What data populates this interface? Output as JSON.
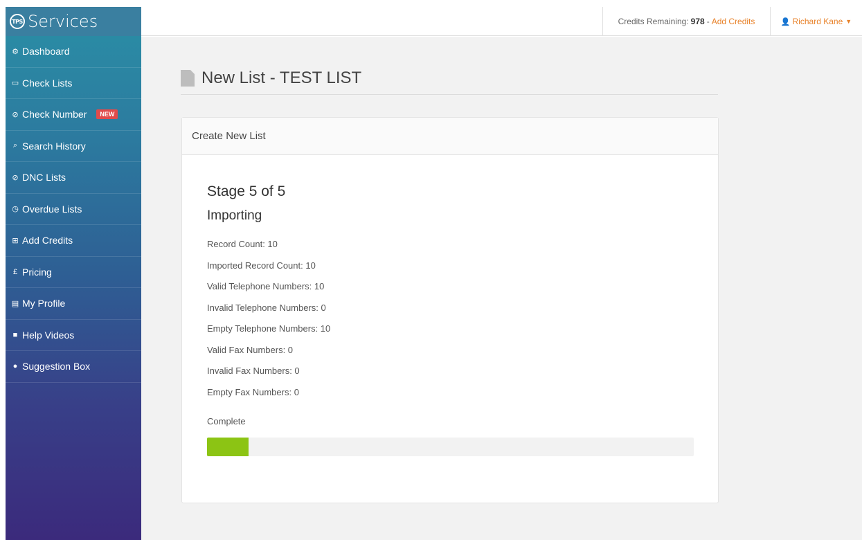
{
  "brand": {
    "logo_text": "TPS",
    "name": "Services"
  },
  "sidebar": {
    "items": [
      {
        "label": "Dashboard",
        "icon": "cogs-icon"
      },
      {
        "label": "Check Lists",
        "icon": "folder-open-icon"
      },
      {
        "label": "Check Number",
        "icon": "check-circle-icon",
        "badge": "NEW"
      },
      {
        "label": "Search History",
        "icon": "search-icon"
      },
      {
        "label": "DNC Lists",
        "icon": "ban-icon"
      },
      {
        "label": "Overdue Lists",
        "icon": "clock-icon"
      },
      {
        "label": "Add Credits",
        "icon": "cart-icon"
      },
      {
        "label": "Pricing",
        "icon": "pound-icon"
      },
      {
        "label": "My Profile",
        "icon": "id-card-icon"
      },
      {
        "label": "Help Videos",
        "icon": "video-camera-icon"
      },
      {
        "label": "Suggestion Box",
        "icon": "comment-icon"
      }
    ]
  },
  "topbar": {
    "credits_label": "Credits Remaining:",
    "credits_value": "978",
    "separator": "-",
    "add_credits_link": "Add Credits",
    "user_name": "Richard Kane"
  },
  "page": {
    "title": "New List - TEST LIST"
  },
  "panel": {
    "heading": "Create New List",
    "stage": "Stage 5 of 5",
    "status": "Importing",
    "stats": [
      "Record Count: 10",
      "Imported Record Count: 10",
      "Valid Telephone Numbers: 10",
      "Invalid Telephone Numbers: 0",
      "Empty Telephone Numbers: 10",
      "Valid Fax Numbers: 0",
      "Invalid Fax Numbers: 0",
      "Empty Fax Numbers: 0"
    ],
    "progress_label": "Complete",
    "progress_fraction": 0.085
  },
  "colors": {
    "accent": "#e8822a",
    "progress": "#8cc414",
    "badge": "#e04b4b"
  }
}
